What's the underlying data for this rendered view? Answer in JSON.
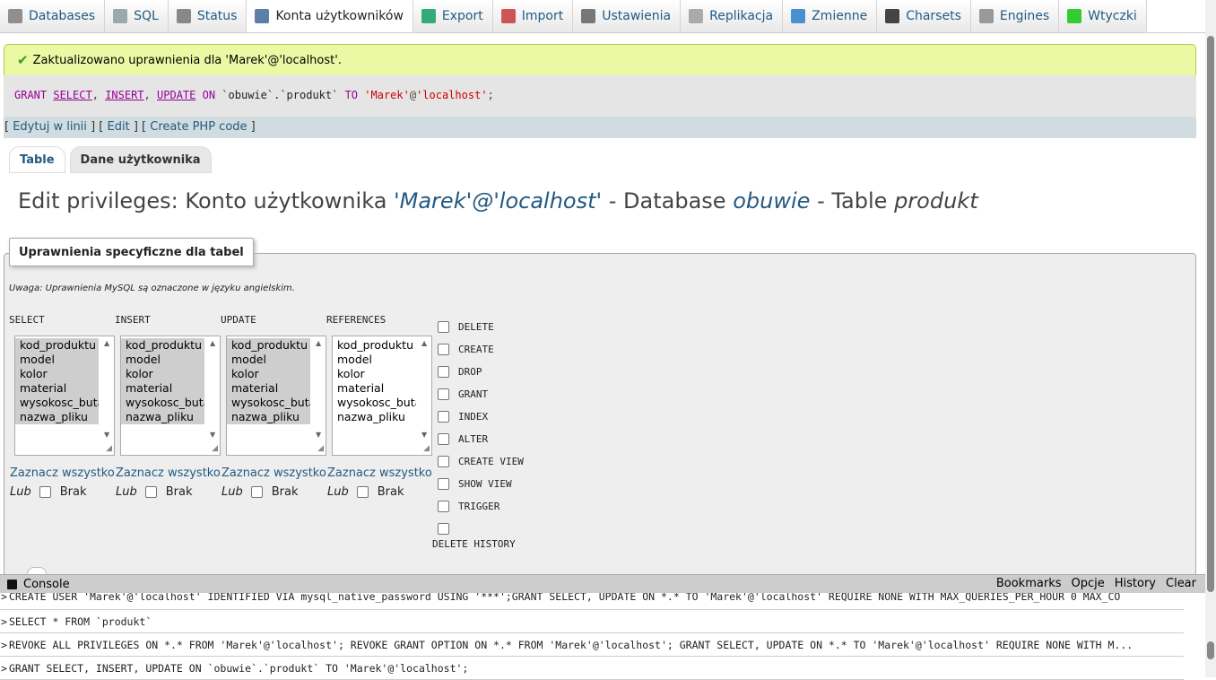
{
  "tabs": [
    {
      "label": "Databases",
      "icon": "databases-icon",
      "color": "#8f8f8f"
    },
    {
      "label": "SQL",
      "icon": "sql-icon",
      "color": "#9aa"
    },
    {
      "label": "Status",
      "icon": "status-icon",
      "color": "#888"
    },
    {
      "label": "Konta użytkowników",
      "icon": "users-icon",
      "color": "#5b7fa6",
      "active": true
    },
    {
      "label": "Export",
      "icon": "export-icon",
      "color": "#3a7"
    },
    {
      "label": "Import",
      "icon": "import-icon",
      "color": "#c55"
    },
    {
      "label": "Ustawienia",
      "icon": "settings-icon",
      "color": "#777"
    },
    {
      "label": "Replikacja",
      "icon": "replication-icon",
      "color": "#aaa"
    },
    {
      "label": "Zmienne",
      "icon": "variables-icon",
      "color": "#4a8fd0"
    },
    {
      "label": "Charsets",
      "icon": "charsets-icon",
      "color": "#444"
    },
    {
      "label": "Engines",
      "icon": "engines-icon",
      "color": "#999"
    },
    {
      "label": "Wtyczki",
      "icon": "plugins-icon",
      "color": "#3c3"
    }
  ],
  "message": "Zaktualizowano uprawnienia dla 'Marek'@'localhost'.",
  "sql": {
    "grant": "GRANT",
    "select": "SELECT",
    "insert": "INSERT",
    "update": "UPDATE",
    "on": "ON",
    "target": "`obuwie`.`produkt`",
    "to": "TO",
    "user": "'Marek'",
    "at": "@",
    "host": "'localhost'",
    "end": ";",
    "comma": ","
  },
  "tools": {
    "open": "[",
    "close": "]",
    "edit_inline": "Edytuj w linii",
    "edit": "Edit",
    "create_php": "Create PHP code"
  },
  "subtabs": {
    "table": "Table",
    "user_data": "Dane użytkownika"
  },
  "heading": {
    "prefix": "Edit privileges: Konto użytkownika",
    "user": "'Marek'@'localhost'",
    "db_label": "- Database",
    "db": "obuwie",
    "tbl_label": "- Table",
    "tbl": "produkt"
  },
  "fieldset": {
    "legend": "Uprawnienia specyficzne dla tabel",
    "note": "Uwaga: Uprawnienia MySQL są oznaczone w języku angielskim."
  },
  "columns": {
    "items": [
      "kod_produktu",
      "model",
      "kolor",
      "material",
      "wysokosc_buta",
      "nazwa_pliku"
    ],
    "select_all": "Zaznacz wszystko",
    "or": "Lub",
    "none": "Brak",
    "list": [
      {
        "header": "SELECT",
        "selected": true
      },
      {
        "header": "INSERT",
        "selected": true
      },
      {
        "header": "UPDATE",
        "selected": true
      },
      {
        "header": "REFERENCES",
        "selected": false
      }
    ]
  },
  "privileges": [
    "DELETE",
    "CREATE",
    "DROP",
    "GRANT",
    "INDEX",
    "ALTER",
    "CREATE VIEW",
    "SHOW VIEW",
    "TRIGGER",
    ""
  ],
  "delete_history": "DELETE HISTORY",
  "console": {
    "title": "Console",
    "actions": [
      "Bookmarks",
      "Opcje",
      "History",
      "Clear"
    ],
    "prompt": ">",
    "lines": [
      "CREATE USER 'Marek'@'localhost' IDENTIFIED VIA mysql_native_password USING '***';GRANT SELECT, UPDATE ON *.* TO 'Marek'@'localhost' REQUIRE NONE WITH MAX_QUERIES_PER_HOUR 0 MAX_CO",
      "SELECT * FROM `produkt`",
      "REVOKE ALL PRIVILEGES ON *.* FROM 'Marek'@'localhost'; REVOKE GRANT OPTION ON *.* FROM 'Marek'@'localhost'; GRANT SELECT, UPDATE ON *.* TO 'Marek'@'localhost' REQUIRE NONE WITH M...",
      "GRANT SELECT, INSERT, UPDATE ON `obuwie`.`produkt` TO 'Marek'@'localhost';"
    ]
  }
}
